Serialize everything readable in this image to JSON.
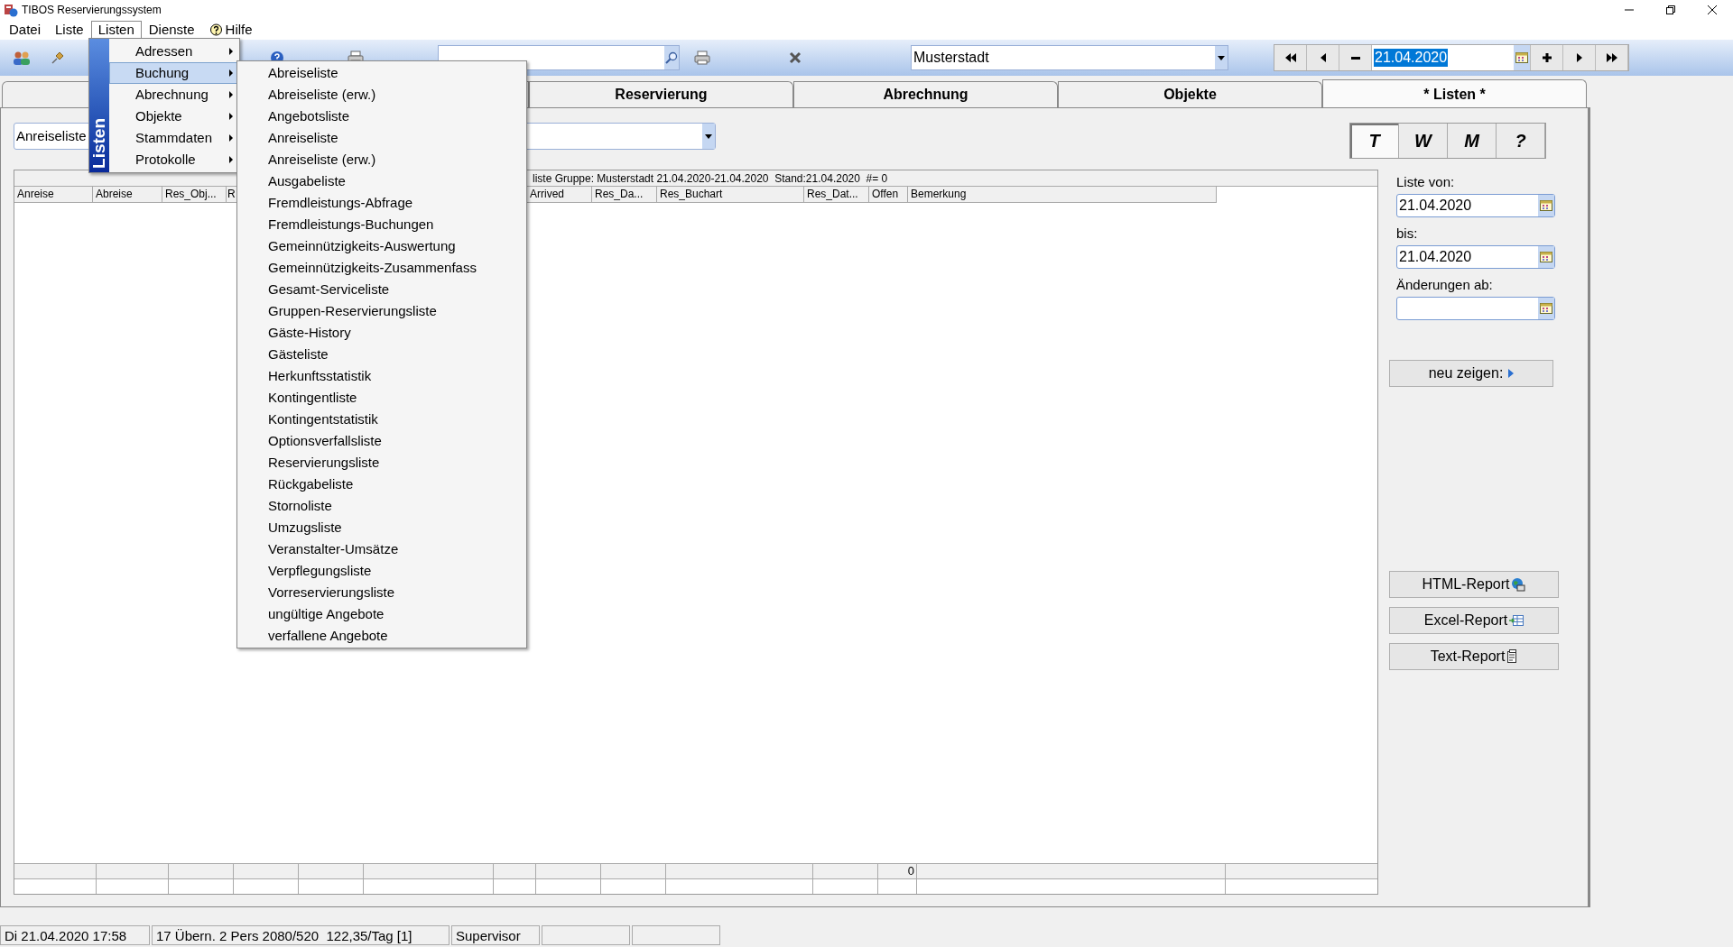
{
  "window": {
    "title": "TIBOS Reservierungssystem"
  },
  "menu_bar": [
    {
      "label": "Datei",
      "open": false
    },
    {
      "label": "Liste",
      "open": false
    },
    {
      "label": "Listen",
      "open": true
    },
    {
      "label": "Dienste",
      "open": false
    },
    {
      "label": "Hilfe",
      "open": false,
      "kind": "help"
    }
  ],
  "toolbar": {
    "location": "Musterstadt",
    "date": "21.04.2020",
    "date_selected": true
  },
  "tabs": [
    {
      "label": "Reservierung",
      "selected": false
    },
    {
      "label": "Abrechnung",
      "selected": false
    },
    {
      "label": "Objekte",
      "selected": false
    },
    {
      "label": "* Listen *",
      "selected": true
    }
  ],
  "list_select": {
    "value": "Anreiseliste"
  },
  "table": {
    "caption": "liste Gruppe: Musterstadt 21.04.2020-21.04.2020  Stand:21.04.2020  #= 0",
    "columns": [
      "Anreise",
      "Abreise",
      "Res_Obj...",
      "R",
      "Arrived",
      "Res_Da...",
      "Res_Buchart",
      "Res_Dat...",
      "Offen",
      "Bemerkung"
    ],
    "totals_row": {
      "offen": "0"
    }
  },
  "period_buttons": [
    {
      "label": "T",
      "selected": true
    },
    {
      "label": "W",
      "selected": false
    },
    {
      "label": "M",
      "selected": false
    },
    {
      "label": "?",
      "selected": false
    }
  ],
  "filters": [
    {
      "label": "Liste von:",
      "value": "21.04.2020"
    },
    {
      "label": "bis:",
      "value": "21.04.2020"
    },
    {
      "label": "Änderungen ab:"
    }
  ],
  "refresh_button": "neu zeigen:",
  "report_buttons": [
    {
      "label": "HTML-Report",
      "kind": "html"
    },
    {
      "label": "Excel-Report",
      "kind": "excel"
    },
    {
      "label": "Text-Report",
      "kind": "text"
    }
  ],
  "status_bar": [
    "Di 21.04.2020 17:58",
    "17 Übern. 2 Pers 2080/520  122,35/Tag [1]",
    "Supervisor"
  ],
  "listen_menu": {
    "banner": "Listen",
    "items": [
      {
        "label": "Adressen",
        "selected": false
      },
      {
        "label": "Buchung",
        "selected": true
      },
      {
        "label": "Abrechnung",
        "selected": false
      },
      {
        "label": "Objekte",
        "selected": false
      },
      {
        "label": "Stammdaten",
        "selected": false
      },
      {
        "label": "Protokolle",
        "selected": false
      }
    ]
  },
  "submenu": {
    "items": [
      "Abreiseliste",
      "Abreiseliste (erw.)",
      "Angebotsliste",
      "Anreiseliste",
      "Anreiseliste (erw.)",
      "Ausgabeliste",
      "Fremdleistungs-Abfrage",
      "Fremdleistungs-Buchungen",
      "Gemeinnützigkeits-Auswertung",
      "Gemeinnützigkeits-Zusammenfass",
      "Gesamt-Serviceliste",
      "Gruppen-Reservierungsliste",
      "Gäste-History",
      "Gästeliste",
      "Herkunftsstatistik",
      "Kontingentliste",
      "Kontingentstatistik",
      "Optionsverfallsliste",
      "Reservierungsliste",
      "Rückgabeliste",
      "Stornoliste",
      "Umzugsliste",
      "Veranstalter-Umsätze",
      "Verpflegungsliste",
      "Vorreservierungsliste",
      "ungültige Angebote",
      "verfallene Angebote"
    ]
  }
}
